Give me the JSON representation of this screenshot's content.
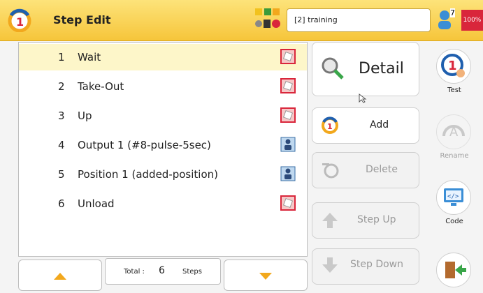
{
  "header": {
    "title": "Step Edit",
    "mode_value": "[2] training",
    "user_count": "7",
    "battery": "100%"
  },
  "steps": [
    {
      "num": "1",
      "label": "Wait",
      "icon": "step-type-icon",
      "selected": true
    },
    {
      "num": "2",
      "label": "Take-Out",
      "icon": "step-type-icon"
    },
    {
      "num": "3",
      "label": "Up",
      "icon": "step-type-icon"
    },
    {
      "num": "4",
      "label": "Output 1 (#8-pulse-5sec)",
      "icon": "robot-output-icon"
    },
    {
      "num": "5",
      "label": "Position 1 (added-position)",
      "icon": "robot-output-icon"
    },
    {
      "num": "6",
      "label": "Unload",
      "icon": "step-type-icon"
    }
  ],
  "footer": {
    "total_label": "Total :",
    "total_value": "6",
    "total_unit": "Steps"
  },
  "actions": {
    "detail": "Detail",
    "add": "Add",
    "delete": "Delete",
    "step_up": "Step Up",
    "step_down": "Step Down"
  },
  "rail": {
    "test": "Test",
    "rename": "Rename",
    "code": "Code"
  },
  "colors": {
    "accent_yellow": "#f6c53a",
    "selected_row": "#fdf6c9",
    "arrow_orange": "#f2a81d",
    "stop_red": "#d9263b"
  }
}
